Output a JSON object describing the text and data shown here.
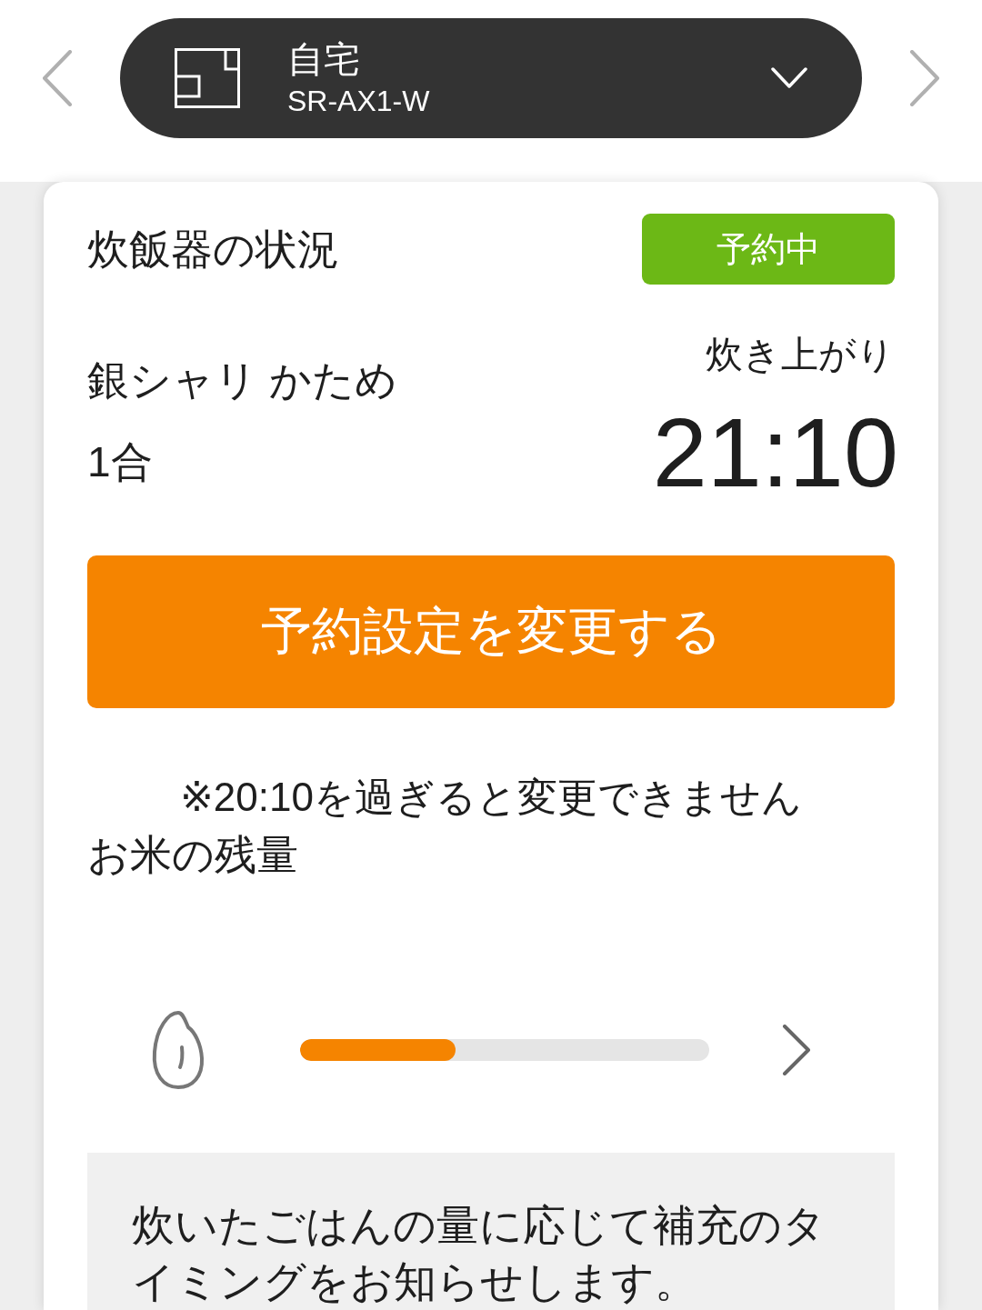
{
  "device_selector": {
    "location": "自宅",
    "model": "SR-AX1-W"
  },
  "status_card": {
    "title": "炊飯器の状況",
    "badge": "予約中",
    "course": "銀シャリ かため",
    "amount": "1合",
    "finish_label": "炊き上がり",
    "finish_time": "21:10",
    "change_button": "予約設定を変更する",
    "note": "※20:10を過ぎると変更できません"
  },
  "rice_remaining": {
    "title": "お米の残量",
    "level": 0.38,
    "info": "炊いたごはんの量に応じて補充のタイミングをお知らせします。"
  }
}
